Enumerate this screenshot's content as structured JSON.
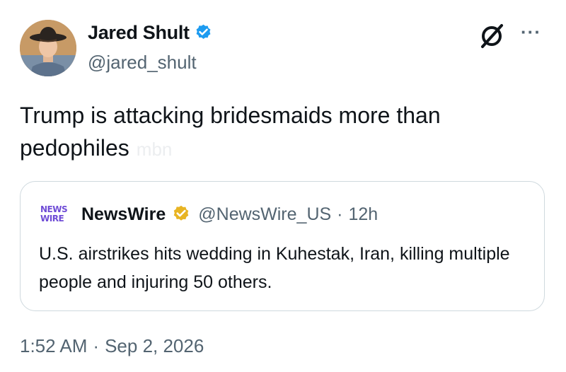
{
  "author": {
    "display_name": "Jared Shult",
    "handle": "@jared_shult",
    "verified": true,
    "verified_color": "#1d9bf0",
    "avatar_icon": "avatar-photo-cowboy-hat"
  },
  "header_actions": {
    "grok_icon": "grok-icon",
    "more_label": "···"
  },
  "tweet": {
    "text": "Trump is attacking bridesmaids more than pedophiles",
    "watermark": "mbn"
  },
  "quote": {
    "avatar_line1": "NEWS",
    "avatar_line2": "WIRE",
    "name": "NewsWire",
    "verified_badge_color": "#e8b423",
    "handle": "@NewsWire_US",
    "separator": "·",
    "time": "12h",
    "text": "U.S. airstrikes hits wedding in Kuhestak, Iran, killing multiple people and injuring 50 others."
  },
  "meta": {
    "time": "1:52 AM",
    "separator": "·",
    "date": "Sep 2, 2026"
  }
}
